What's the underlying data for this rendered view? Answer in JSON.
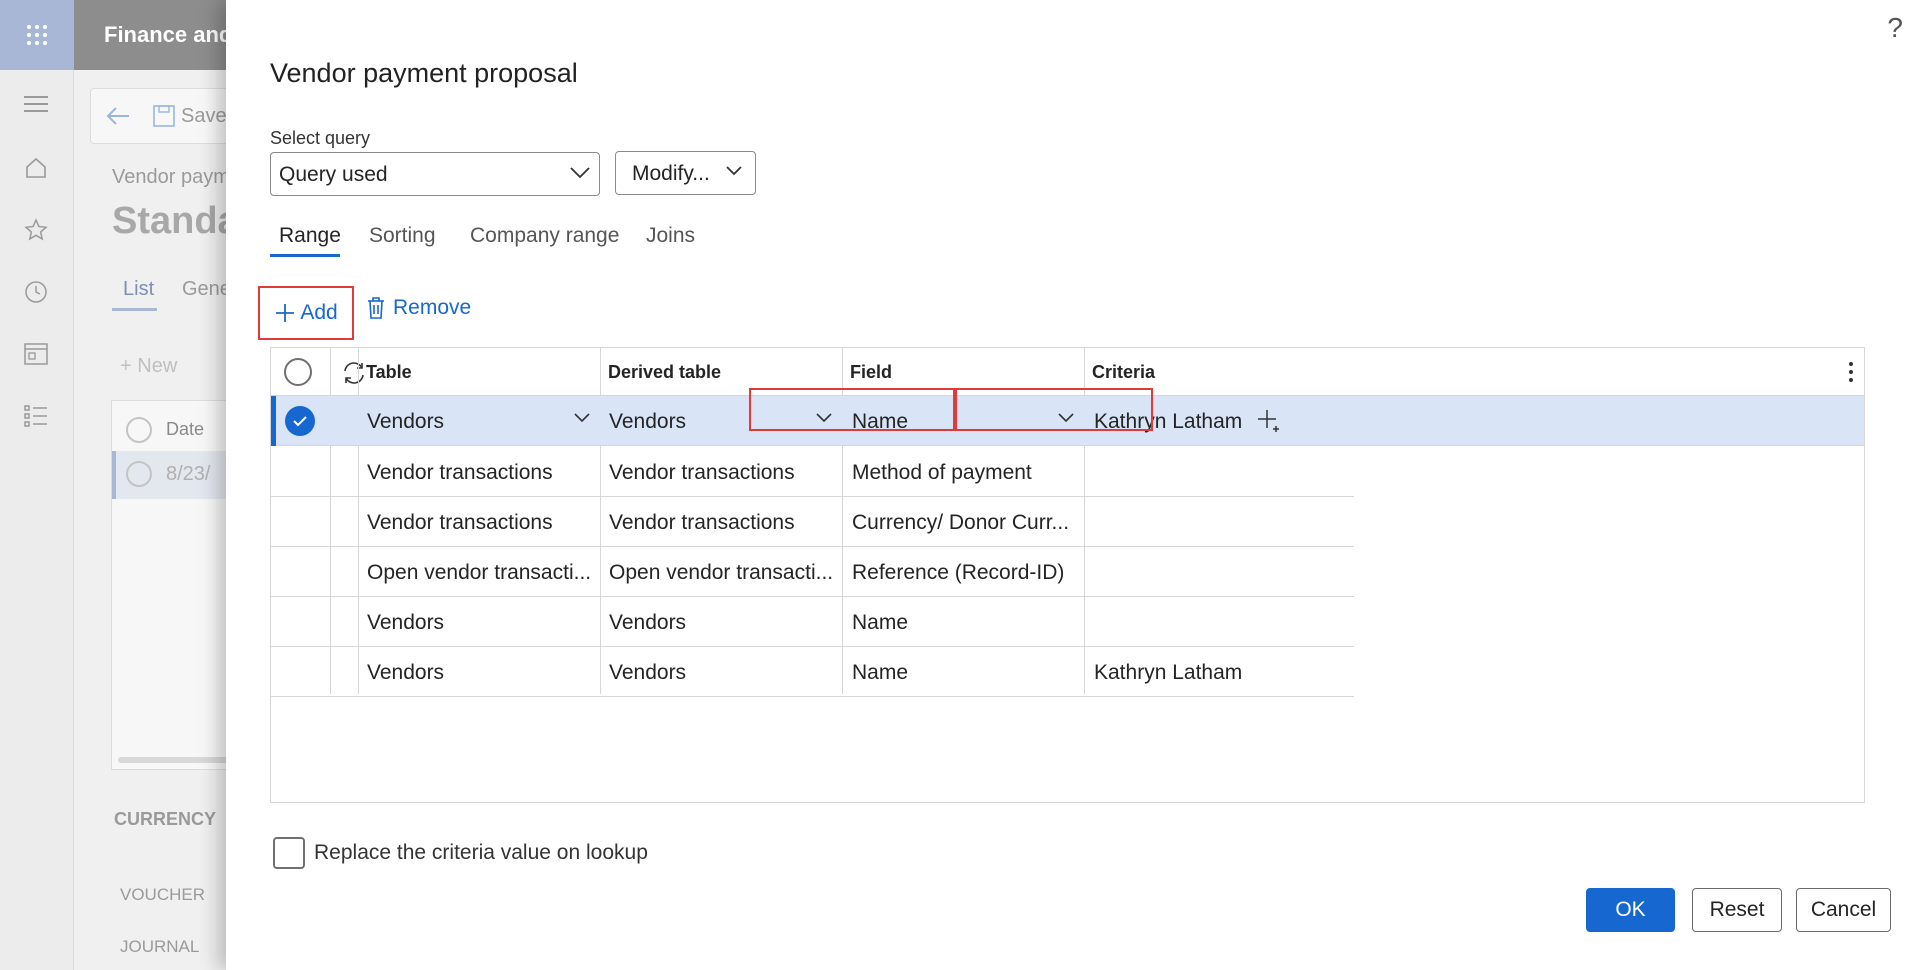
{
  "background": {
    "app_title": "Finance and",
    "toolbar_save": "Save",
    "breadcrumb": "Vendor paym",
    "page_title": "Standa",
    "tabs": [
      "List",
      "Gene"
    ],
    "new_label": "New",
    "list_header_date": "Date",
    "list_row_date": "8/23/",
    "section_currency": "CURRENCY",
    "section_voucher": "VOUCHER",
    "section_journal": "JOURNAL"
  },
  "dialog": {
    "help": "?",
    "title": "Vendor payment proposal",
    "select_query_label": "Select query",
    "select_query_value": "Query used",
    "modify_label": "Modify...",
    "tabs": [
      "Range",
      "Sorting",
      "Company range",
      "Joins"
    ],
    "active_tab": "Range",
    "add_label": "Add",
    "remove_label": "Remove",
    "grid": {
      "columns": [
        "Table",
        "Derived table",
        "Field",
        "Criteria"
      ],
      "rows": [
        {
          "table": "Vendors",
          "derived": "Vendors",
          "field": "Name",
          "criteria": "Kathryn Latham",
          "selected": true
        },
        {
          "table": "Vendor transactions",
          "derived": "Vendor transactions",
          "field": "Method of payment",
          "criteria": ""
        },
        {
          "table": "Vendor transactions",
          "derived": "Vendor transactions",
          "field": "Currency/ Donor Curr...",
          "criteria": ""
        },
        {
          "table": "Open vendor transacti...",
          "derived": "Open vendor transacti...",
          "field": "Reference (Record-ID)",
          "criteria": ""
        },
        {
          "table": "Vendors",
          "derived": "Vendors",
          "field": "Name",
          "criteria": ""
        },
        {
          "table": "Vendors",
          "derived": "Vendors",
          "field": "Name",
          "criteria": "Kathryn Latham"
        }
      ]
    },
    "replace_checkbox_label": "Replace the criteria value on lookup",
    "ok_label": "OK",
    "reset_label": "Reset",
    "cancel_label": "Cancel"
  },
  "colors": {
    "accent": "#1767d0",
    "highlight": "#e03b3b",
    "selected_row": "#d9e5f7"
  }
}
